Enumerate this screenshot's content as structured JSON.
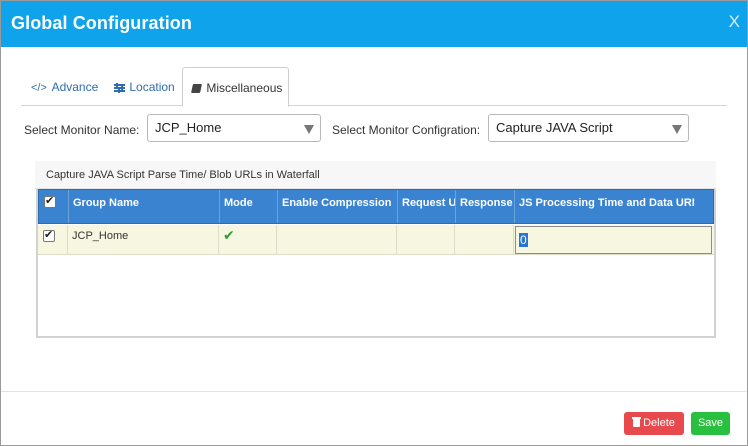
{
  "window": {
    "title": "Global Configuration",
    "close_glyph": "X"
  },
  "tabs": [
    {
      "icon": "code-icon",
      "icon_glyph": "</>",
      "label": "Advance"
    },
    {
      "icon": "sliders-icon",
      "label": "Location"
    },
    {
      "icon": "book-icon",
      "label": "Miscellaneous"
    }
  ],
  "form": {
    "monitor_name_label": "Select Monitor Name:",
    "monitor_name_value": "JCP_Home",
    "monitor_config_label": "Select Monitor Configration:",
    "monitor_config_value": "Capture JAVA Script"
  },
  "panel": {
    "title": "Capture JAVA Script Parse Time/ Blob URLs in Waterfall",
    "columns": [
      "Group Name",
      "Mode",
      "Enable Compression",
      "Request U",
      "Response",
      "JS Processing Time and Data URI"
    ],
    "rows": [
      {
        "checked": true,
        "group_name": "JCP_Home",
        "mode_icon": "checkmark-icon",
        "mode_glyph": "✔",
        "enable_compression": "",
        "request": "",
        "response": "",
        "js_processing": "0"
      }
    ]
  },
  "footer": {
    "delete_label": "Delete",
    "save_label": "Save"
  },
  "colors": {
    "titlebar": "#0fa3ec",
    "grid_header": "#3a83d1",
    "row_bg": "#f6f6e1",
    "delete": "#e8494d",
    "save": "#2ac03f",
    "link": "#2f6db0"
  }
}
